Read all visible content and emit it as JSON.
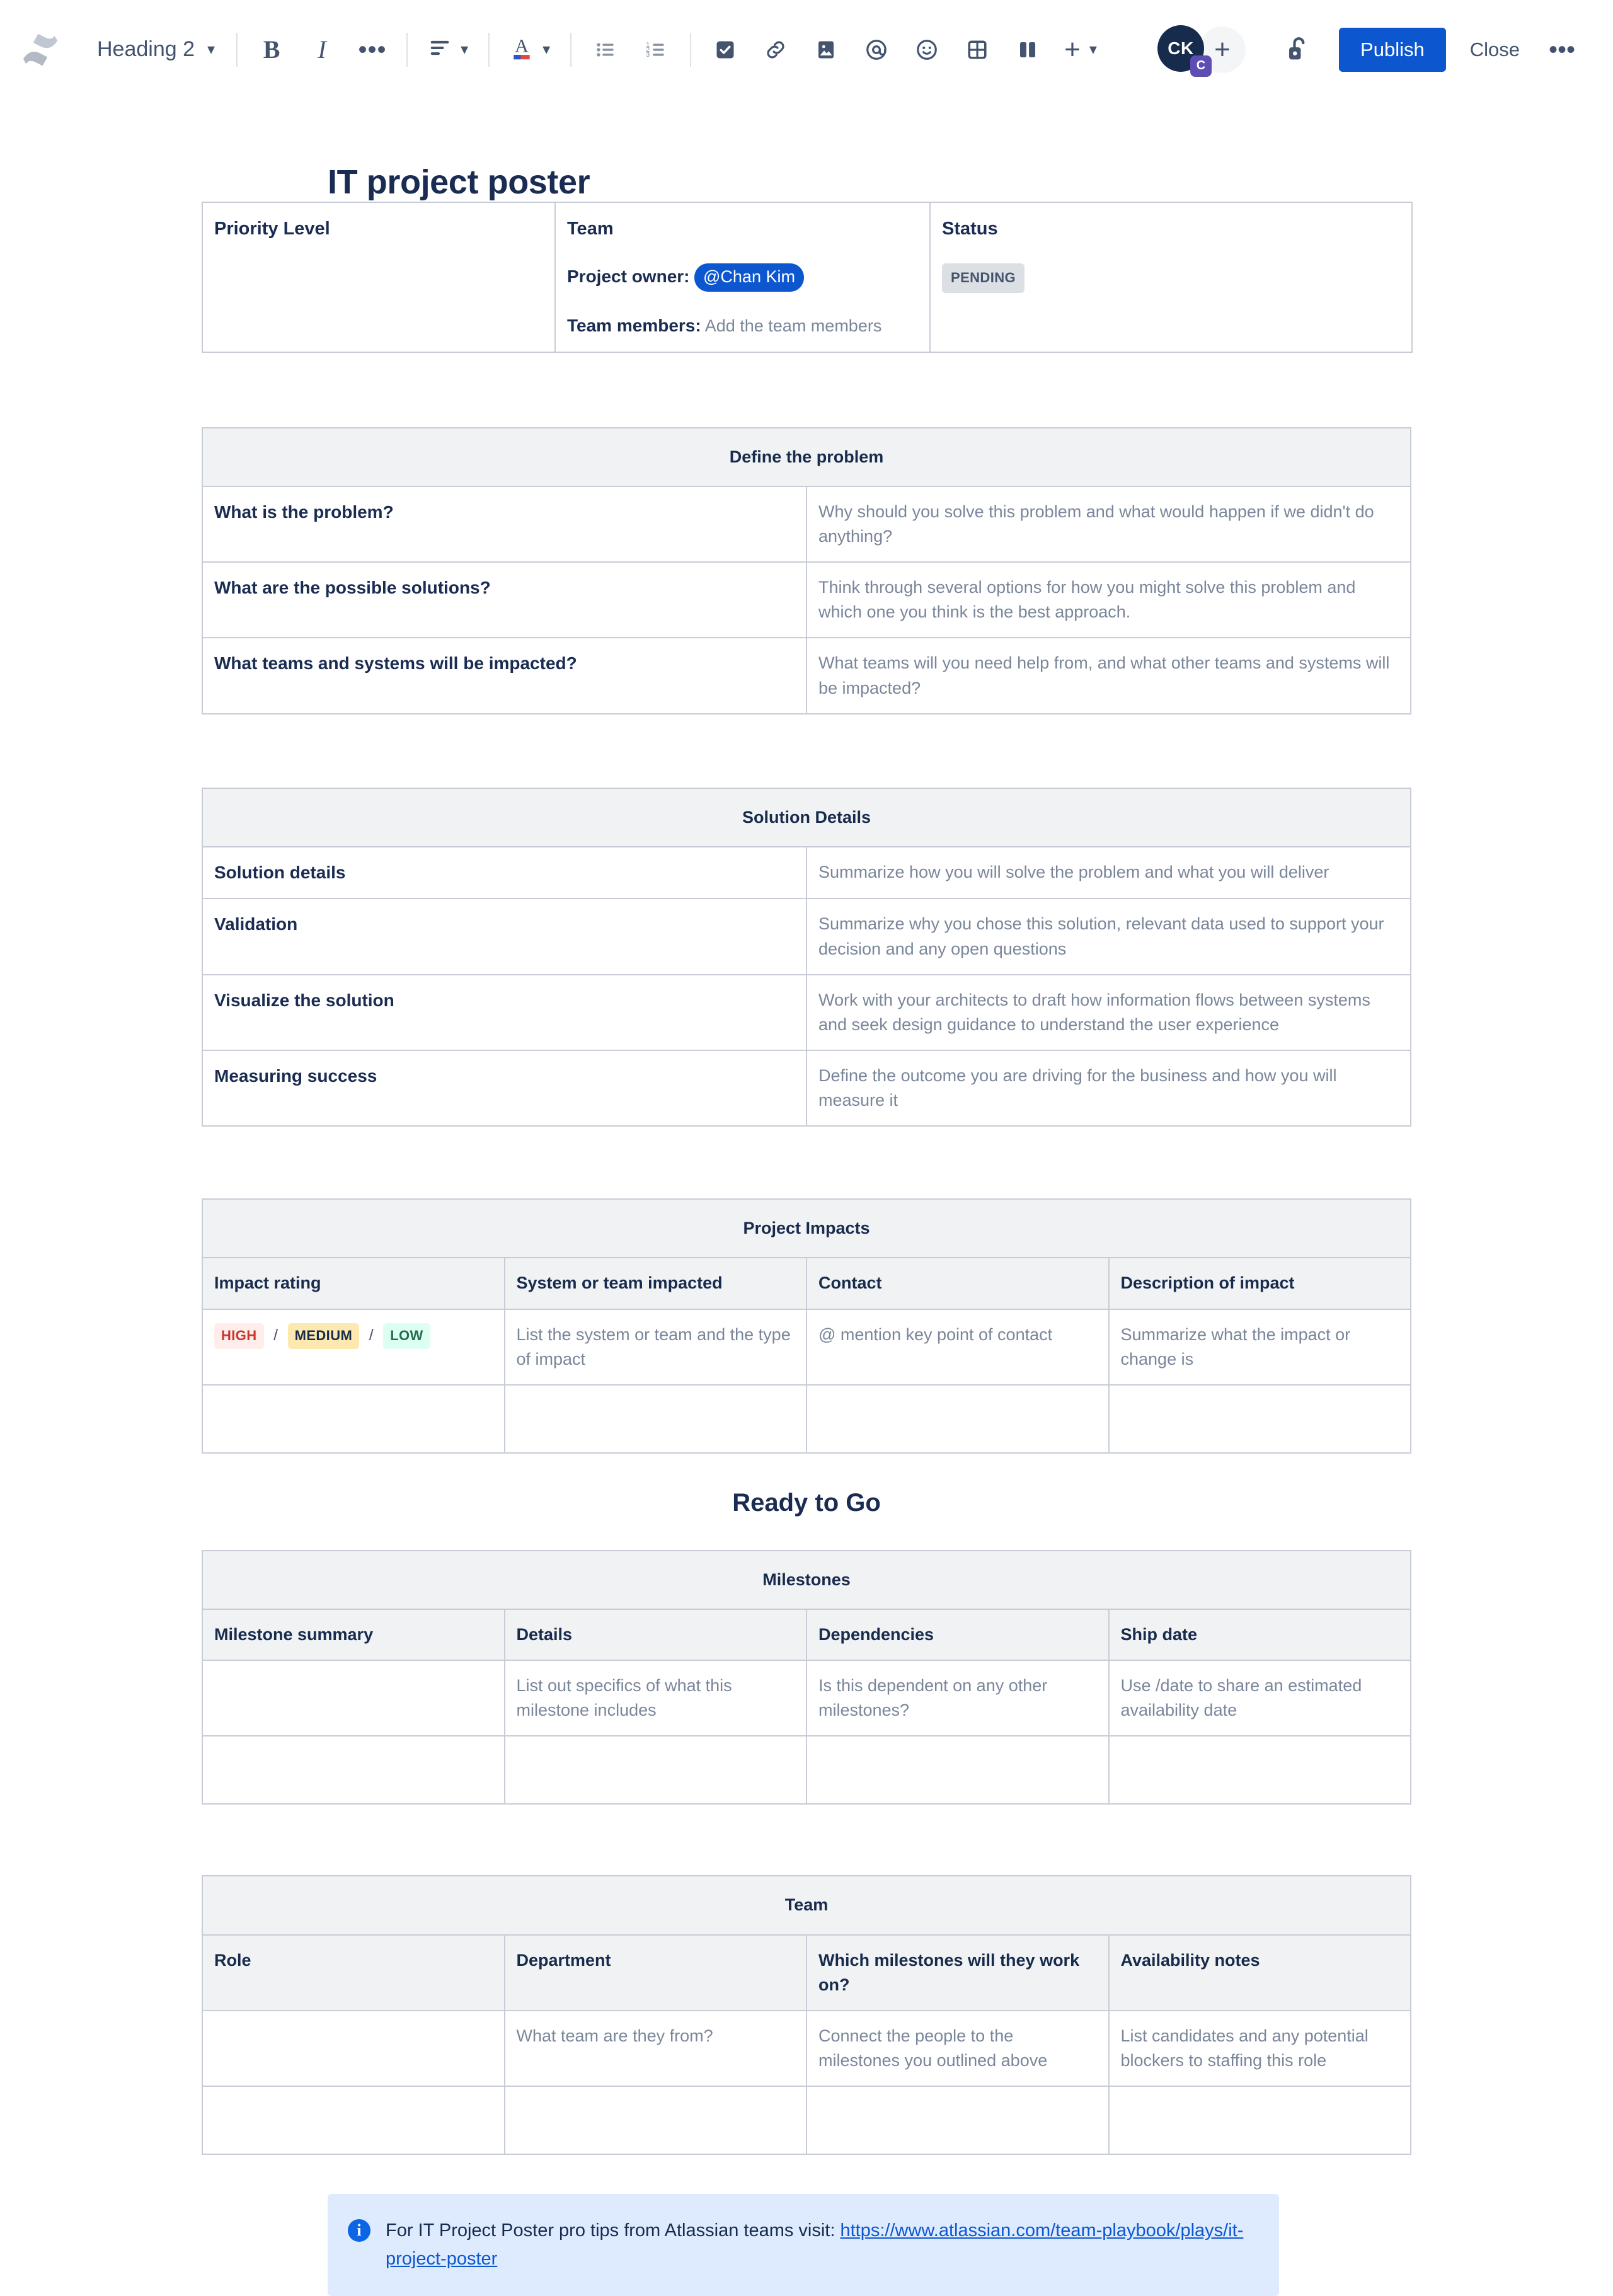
{
  "toolbar": {
    "logo_icon": "confluence-logo-icon",
    "text_style": "Heading 2",
    "text_style_chevron": "chevron-down-icon",
    "bold_label": "B",
    "italic_label": "I",
    "more_formatting_label": "•••",
    "align_icon": "text-align-icon",
    "align_chevron": "chevron-down-icon",
    "text_color_label": "A",
    "text_color_chevron": "chevron-down-icon",
    "bullet_list_icon": "bullet-list-icon",
    "numbered_list_icon": "numbered-list-icon",
    "task_icon": "checkbox-task-icon",
    "link_icon": "link-icon",
    "image_icon": "image-icon",
    "mention_icon": "mention-at-icon",
    "emoji_icon": "emoji-smiley-icon",
    "table_icon": "table-icon",
    "layout_icon": "page-layout-icon",
    "insert_label": "+",
    "insert_chevron": "chevron-down-icon",
    "avatar_initials": "CK",
    "avatar_badge": "C",
    "add_person_label": "+",
    "restrictions_icon": "unlocked-padlock-icon",
    "publish_label": "Publish",
    "close_label": "Close",
    "more_label": "•••"
  },
  "document": {
    "title": "IT project poster",
    "overview": {
      "columns": [
        "Priority Level",
        "Team",
        "Status"
      ],
      "team": {
        "owner_label": "Project owner:",
        "owner_mention": "@Chan Kim",
        "members_label": "Team members:",
        "members_placeholder": "Add the team members"
      },
      "status_chip": "PENDING",
      "priority_value": ""
    },
    "define_problem": {
      "title": "Define the problem",
      "rows": [
        {
          "label": "What is the problem?",
          "placeholder": "Why should you solve this problem and what would happen if we didn't do anything?"
        },
        {
          "label": "What are the possible solutions?",
          "placeholder": "Think through several options for how you might solve this problem and which one you think is the best approach."
        },
        {
          "label": "What teams and systems will be impacted?",
          "placeholder": "What teams will you need help from, and what other teams and systems will be impacted?"
        }
      ]
    },
    "solution_details": {
      "title": "Solution Details",
      "rows": [
        {
          "label": "Solution details",
          "placeholder": "Summarize how you will solve the problem and what you will deliver"
        },
        {
          "label": "Validation",
          "placeholder": "Summarize why you chose this solution, relevant data used to support your decision and any open questions"
        },
        {
          "label": "Visualize the solution",
          "placeholder": "Work with your architects to draft how information flows between systems and seek design guidance to understand the user experience"
        },
        {
          "label": "Measuring success",
          "placeholder": "Define the outcome you are driving for the business and how you will measure it"
        }
      ]
    },
    "project_impacts": {
      "title": "Project Impacts",
      "columns": [
        "Impact rating",
        "System or team impacted",
        "Contact",
        "Description of impact"
      ],
      "ratings": {
        "high": "HIGH",
        "medium": "MEDIUM",
        "low": "LOW",
        "separator": "/"
      },
      "row": {
        "system_placeholder": "List the system or team and the type of impact",
        "contact_placeholder": "@ mention key point of contact",
        "description_placeholder": "Summarize what the impact or change is"
      },
      "empty_row": [
        "",
        "",
        "",
        ""
      ]
    },
    "ready_heading": "Ready to Go",
    "milestones": {
      "title": "Milestones",
      "columns": [
        "Milestone summary",
        "Details",
        "Dependencies",
        "Ship date"
      ],
      "row": {
        "summary": "",
        "details_placeholder": "List out specifics of what this milestone includes",
        "dependencies_placeholder": "Is this dependent on any other milestones?",
        "ship_date_placeholder": "Use /date to share an estimated availability date"
      },
      "empty_row": [
        "",
        "",
        "",
        ""
      ]
    },
    "team_table": {
      "title": "Team",
      "columns": [
        "Role",
        "Department",
        "Which milestones will they work on?",
        "Availability notes"
      ],
      "row": {
        "role": "",
        "department_placeholder": "What team are they from?",
        "milestones_placeholder": "Connect the people to the milestones you outlined above",
        "availability_placeholder": "List candidates and any potential blockers to staffing this role"
      },
      "empty_row": [
        "",
        "",
        "",
        ""
      ]
    },
    "info_panel": {
      "icon": "info-circle-icon",
      "text": "For IT Project Poster pro tips from Atlassian teams visit: ",
      "link_text": "https://www.atlassian.com/team-playbook/plays/it-project-poster"
    }
  },
  "colors": {
    "brand_blue": "#0C56D0",
    "mention_blue": "#0C56D0",
    "panel_blue": "#DEEBFF",
    "text_dark": "#172B4D",
    "heading_dark": "#1A2C52",
    "placeholder": "#7A869A",
    "table_border": "#C7CCD6",
    "table_header_bg": "#F1F2F4",
    "badge_high_bg": "#FFEDEB",
    "badge_high_fg": "#C9372C",
    "badge_medium_bg": "#FDE9B0",
    "badge_low_bg": "#DCFFF1",
    "badge_low_fg": "#216E4E",
    "status_chip_bg": "#DCDFE4"
  }
}
